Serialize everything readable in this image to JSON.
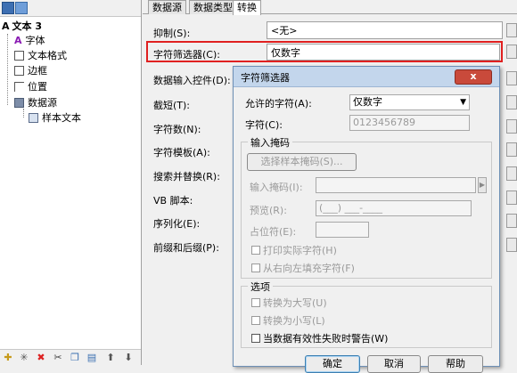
{
  "tree": {
    "root": "文本 3",
    "items": [
      "字体",
      "文本格式",
      "边框",
      "位置",
      "数据源"
    ],
    "child": "样本文本",
    "toolbar_icons": [
      "add-icon",
      "delete-icon",
      "cut-icon",
      "copy-icon",
      "paste-icon",
      "move-up-icon",
      "move-down-icon"
    ]
  },
  "tabs": [
    "数据源",
    "数据类型",
    "转换"
  ],
  "props": {
    "labels": [
      "抑制(S):",
      "字符筛选器(C):",
      "数据输入控件(D):",
      "截短(T):",
      "字符数(N):",
      "字符模板(A):",
      "搜索并替换(R):",
      "VB 脚本:",
      "序列化(E):",
      "前缀和后缀(P):"
    ],
    "suppress_value": "<无>",
    "filter_value": "仅数字"
  },
  "dialog": {
    "title": "字符筛选器",
    "close": "x",
    "allowed_label": "允许的字符(A):",
    "allowed_value": "仅数字",
    "chars_label": "字符(C):",
    "chars_value": "0123456789",
    "mask_group": "输入掩码",
    "select_mask_btn": "选择样本掩码(S)...",
    "mask_label": "输入掩码(I):",
    "preview_label": "预览(R):",
    "preview_value": "(___) ___-____",
    "placeholder_label": "占位符(E):",
    "print_literal": "打印实际字符(H)",
    "fill_rtl": "从右向左填充字符(F)",
    "options_group": "选项",
    "to_upper": "转换为大写(U)",
    "to_lower": "转换为小写(L)",
    "warn_invalid": "当数据有效性失败时警告(W)",
    "ok": "确定",
    "cancel": "取消",
    "help": "帮助"
  }
}
